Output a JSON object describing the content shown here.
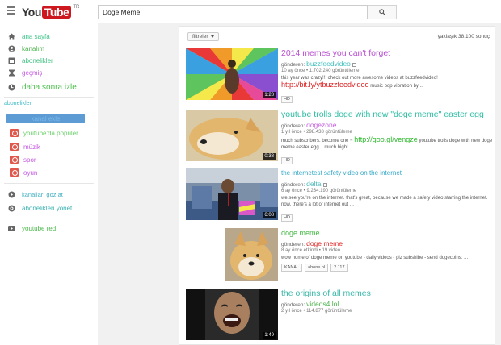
{
  "header": {
    "logo_you": "You",
    "logo_tube": "Tube",
    "logo_tm": "TR",
    "search_value": "Doge Meme"
  },
  "sidebar": {
    "nav": [
      {
        "label": "ana sayfa",
        "color": "#3fc48a",
        "icon": "home-icon"
      },
      {
        "label": "kanalım",
        "color": "#4db34d",
        "icon": "user-icon"
      },
      {
        "label": "abonelikler",
        "color": "#42c282",
        "icon": "subscriptions-icon"
      },
      {
        "label": "geçmiş",
        "color": "#c45ce0",
        "icon": "history-icon"
      },
      {
        "label": "daha sonra izle",
        "color": "#4fc04f",
        "icon": "clock-icon"
      }
    ],
    "subscriptions_heading": "abonelikler",
    "add_channel_label": "kanal ekle",
    "subscriptions": [
      {
        "label": "youtube'da popüler",
        "color": "#6bd06b"
      },
      {
        "label": "müzik",
        "color": "#c45ce0"
      },
      {
        "label": "spor",
        "color": "#c45ce0"
      },
      {
        "label": "oyun",
        "color": "#c45ce0"
      }
    ],
    "manage": [
      {
        "label": "kanalları göz at",
        "color": "#44b0c2",
        "icon": "browse-channels-icon"
      },
      {
        "label": "abonelikleri yönet",
        "color": "#3db3b3",
        "icon": "gear-icon"
      }
    ],
    "youtube_red": {
      "label": "youtube red",
      "color": "#4cb84c"
    }
  },
  "results": {
    "filter_label": "filtreler",
    "count": "yaklaşık 38.100 sonuç",
    "items": [
      {
        "title": "2014 memes you can't forget",
        "title_color": "#b84fd1",
        "by_prefix": "gönderen:",
        "channel": "buzzfeedvideo",
        "channel_color": "#45c0c0",
        "meta": "10 ay önce • 1.702.240 görüntüleme",
        "desc": "this year was crazy!!! check out more awesome videos at buzzfeedvideo!",
        "link": "http://bit.ly/ytbuzzfeedvideo",
        "link_color": "#d22",
        "desc_after": "music pop vibration by ...",
        "badge": "HD",
        "duration": "1:28"
      },
      {
        "title": "youtube trolls doge with new \"doge meme\" easter egg",
        "title_color": "#2fbda4",
        "by_prefix": "gönderen:",
        "channel": "dogezone",
        "channel_color": "#c45ce0",
        "meta": "1 yıl önce • 298.438 görüntüleme",
        "desc": "much subscribers. become one ~",
        "link": "http://goo.gl/vengze",
        "link_color": "#2db82d",
        "desc_after": "youtube trolls doge with new doge meme easter egg... much high!",
        "badge": "HD",
        "duration": "0:38"
      },
      {
        "title": "the internetest safety video on the internet",
        "title_color": "#34a7c8",
        "by_prefix": "gönderen:",
        "channel": "delta",
        "channel_color": "#48b8b8",
        "meta": "6 ay önce • 9.234.190 görüntüleme",
        "desc": "we see you're on the internet. that's great, because we made a safety video starring the internet. now, there's a lot of internet out ...",
        "badge": "HD",
        "duration": "6:08"
      },
      {
        "title": "doge meme",
        "title_color": "#45b845",
        "by_prefix": "gönderen:",
        "channel": "doge meme",
        "channel_color": "#d22",
        "meta": "8 ay önce etkindi • 19 video",
        "desc": "wow home of doge meme on youtube - daily videos - plz subshibe - send dogecoins: ...",
        "kanal_label": "KANAL",
        "subscribe_label": "abone ol",
        "subscriber_count": "2.117"
      },
      {
        "title": "the origins of all memes",
        "title_color": "#3ab8a8",
        "by_prefix": "gönderen:",
        "channel": "videos4 lol",
        "channel_color": "#4db34d",
        "meta": "2 yıl önce • 114.877 görüntüleme",
        "duration": "1:49"
      }
    ]
  }
}
